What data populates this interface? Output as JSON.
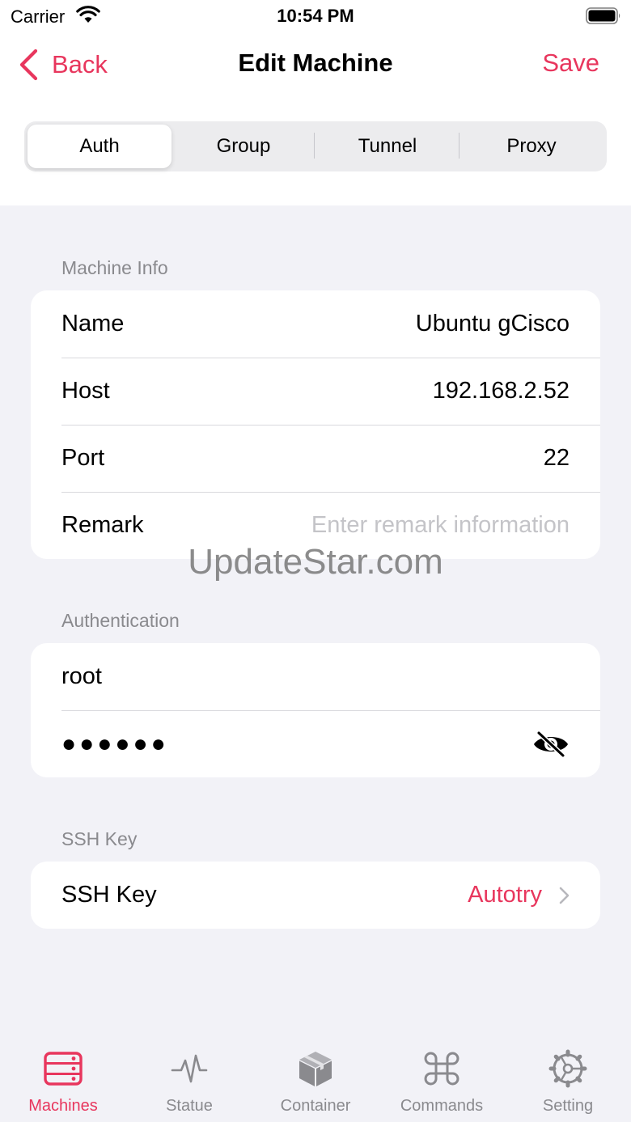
{
  "status_bar": {
    "carrier": "Carrier",
    "time": "10:54 PM"
  },
  "nav": {
    "back_label": "Back",
    "title": "Edit Machine",
    "save_label": "Save"
  },
  "segments": [
    {
      "label": "Auth",
      "selected": true
    },
    {
      "label": "Group",
      "selected": false
    },
    {
      "label": "Tunnel",
      "selected": false
    },
    {
      "label": "Proxy",
      "selected": false
    }
  ],
  "machine_info": {
    "header": "Machine Info",
    "rows": [
      {
        "label": "Name",
        "value": "Ubuntu gCisco"
      },
      {
        "label": "Host",
        "value": "192.168.2.52"
      },
      {
        "label": "Port",
        "value": "22"
      },
      {
        "label": "Remark",
        "value": "",
        "placeholder": "Enter remark information"
      }
    ]
  },
  "watermark": "UpdateStar.com",
  "authentication": {
    "header": "Authentication",
    "username": "root",
    "password_masked": "●●●●●●",
    "password_icon": "eye-slash-icon"
  },
  "ssh_key": {
    "header": "SSH Key",
    "label": "SSH Key",
    "value": "Autotry",
    "icon": "chevron-right-icon"
  },
  "tabs": [
    {
      "label": "Machines",
      "icon": "server-rack-icon",
      "active": true
    },
    {
      "label": "Statue",
      "icon": "pulse-icon",
      "active": false
    },
    {
      "label": "Container",
      "icon": "box-icon",
      "active": false
    },
    {
      "label": "Commands",
      "icon": "command-key-icon",
      "active": false
    },
    {
      "label": "Setting",
      "icon": "gear-icon",
      "active": false
    }
  ],
  "colors": {
    "accent": "#e8365d",
    "background": "#f2f2f7",
    "card": "#ffffff",
    "secondary_text": "#8a8a8e",
    "placeholder": "#c4c4c8",
    "inactive_icon": "#8a8a8e"
  }
}
